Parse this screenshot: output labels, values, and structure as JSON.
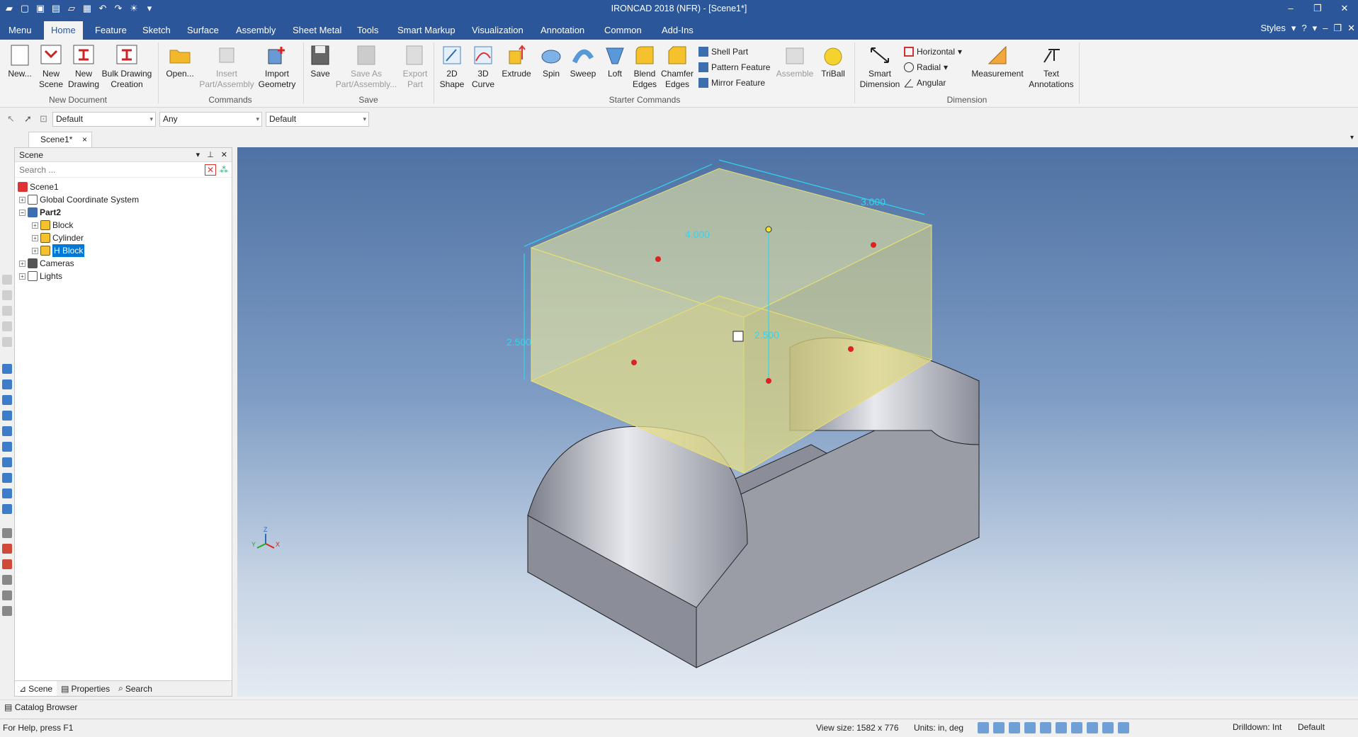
{
  "app": {
    "title": "IRONCAD 2018 (NFR) - [Scene1*]"
  },
  "ribbon_tabs": [
    "Menu",
    "Home",
    "Feature",
    "Sketch",
    "Surface",
    "Assembly",
    "Sheet Metal",
    "Tools",
    "Smart Markup",
    "Visualization",
    "Annotation",
    "Common",
    "Add-Ins"
  ],
  "active_tab": "Home",
  "styles_label": "Styles",
  "ribbon": {
    "new_document": {
      "label": "New Document",
      "buttons": [
        "New...",
        "New Scene",
        "New Drawing",
        "Bulk Drawing Creation"
      ]
    },
    "commands": {
      "label": "Commands",
      "open": "Open...",
      "insert": "Insert Part/Assembly",
      "import": "Import Geometry"
    },
    "save": {
      "label": "Save",
      "save": "Save",
      "save_as": "Save As Part/Assembly...",
      "export": "Export Part"
    },
    "starter": {
      "label": "Starter Commands",
      "shape2d": "2D Shape",
      "curve3d": "3D Curve",
      "extrude": "Extrude",
      "spin": "Spin",
      "sweep": "Sweep",
      "loft": "Loft",
      "blend": "Blend Edges",
      "chamfer": "Chamfer Edges",
      "shell": "Shell Part",
      "pattern": "Pattern Feature",
      "mirror": "Mirror Feature",
      "assemble": "Assemble",
      "triball": "TriBall"
    },
    "dimension": {
      "label": "Dimension",
      "smart": "Smart Dimension",
      "horizontal": "Horizontal",
      "radial": "Radial",
      "angular": "Angular",
      "measurement": "Measurement",
      "text": "Text Annotations"
    }
  },
  "toolbar": {
    "combo1": "Default",
    "combo2": "Any",
    "combo3": "Default"
  },
  "doc_tab": "Scene1*",
  "scene_panel": {
    "title": "Scene",
    "search_placeholder": "Search ...",
    "tree": [
      {
        "label": "Scene1",
        "level": 0,
        "expander": ""
      },
      {
        "label": "Global Coordinate System",
        "level": 1,
        "expander": "+"
      },
      {
        "label": "Part2",
        "level": 1,
        "expander": "−",
        "bold": true
      },
      {
        "label": "Block",
        "level": 2,
        "expander": "+"
      },
      {
        "label": "Cylinder",
        "level": 2,
        "expander": "+"
      },
      {
        "label": "H Block",
        "level": 2,
        "expander": "+",
        "selected": true
      },
      {
        "label": "Cameras",
        "level": 1,
        "expander": "+"
      },
      {
        "label": "Lights",
        "level": 1,
        "expander": "+"
      }
    ],
    "bottom_tabs": [
      "Scene",
      "Properties",
      "Search"
    ]
  },
  "viewport": {
    "dim_width": "4.000",
    "dim_depth": "3.000",
    "dim_height": "2.500",
    "dim_left": "2.500",
    "axis_z": "Z",
    "axis_x": "X",
    "axis_y": "Y"
  },
  "catalog_label": "Catalog Browser",
  "status": {
    "help": "For Help, press F1",
    "view_size": "View size: 1582 x  776",
    "units": "Units: in, deg",
    "drilldown": "Drilldown: Int",
    "style": "Default"
  },
  "colors": {
    "accent": "#2b579a",
    "selection": "#0078d7",
    "intellishape": "#f5f0a0",
    "dimension": "#2fd6f0"
  }
}
